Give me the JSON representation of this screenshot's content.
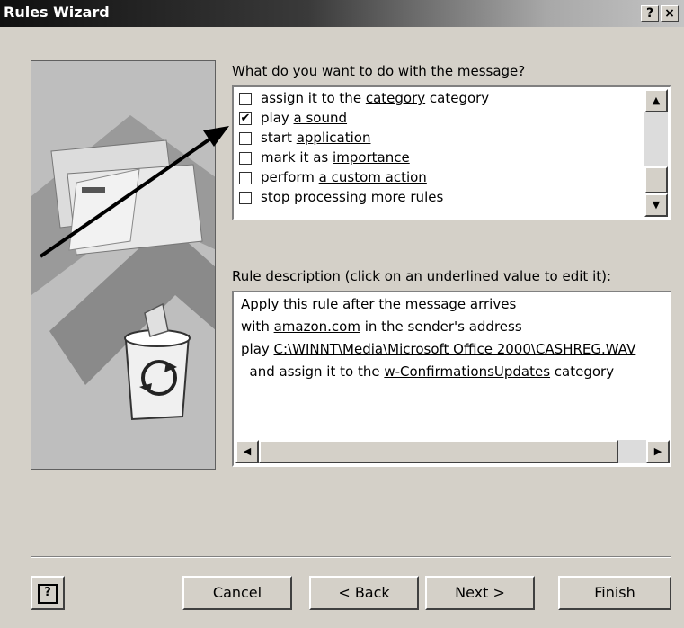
{
  "window": {
    "title": "Rules Wizard",
    "help_glyph": "?",
    "close_glyph": "×"
  },
  "actions": {
    "prompt": "What do you want to do with the message?",
    "items": [
      {
        "checked": false,
        "pre": "assign it to the ",
        "link": "category",
        "post": " category"
      },
      {
        "checked": true,
        "pre": "play ",
        "link": "a sound",
        "post": ""
      },
      {
        "checked": false,
        "pre": "start ",
        "link": "application",
        "post": ""
      },
      {
        "checked": false,
        "pre": "mark it as ",
        "link": "importance",
        "post": ""
      },
      {
        "checked": false,
        "pre": "perform ",
        "link": "a custom action",
        "post": ""
      },
      {
        "checked": false,
        "pre": "stop processing more rules",
        "link": "",
        "post": ""
      }
    ],
    "check_glyph": "✔",
    "scroll_up_glyph": "▲",
    "scroll_down_glyph": "▼"
  },
  "description": {
    "label": "Rule description (click on an underlined value to edit it):",
    "lines": [
      {
        "pre": "Apply this rule after the message arrives",
        "link": "",
        "post": ""
      },
      {
        "pre": "with ",
        "link": "amazon.com",
        "post": " in the sender's address"
      },
      {
        "pre": "play ",
        "link": "C:\\WINNT\\Media\\Microsoft Office 2000\\CASHREG.WAV",
        "post": ""
      },
      {
        "pre": "  and assign it to the ",
        "link": "w-ConfirmationsUpdates",
        "post": " category"
      }
    ],
    "scroll_left_glyph": "◀",
    "scroll_right_glyph": "▶"
  },
  "buttons": {
    "help_glyph": "?",
    "cancel": "Cancel",
    "back": "< Back",
    "next": "Next >",
    "finish": "Finish"
  },
  "colors": {
    "window_bg": "#d4d0c8",
    "titlebar_dark": "#101010",
    "titlebar_light": "#c4c4c4"
  }
}
